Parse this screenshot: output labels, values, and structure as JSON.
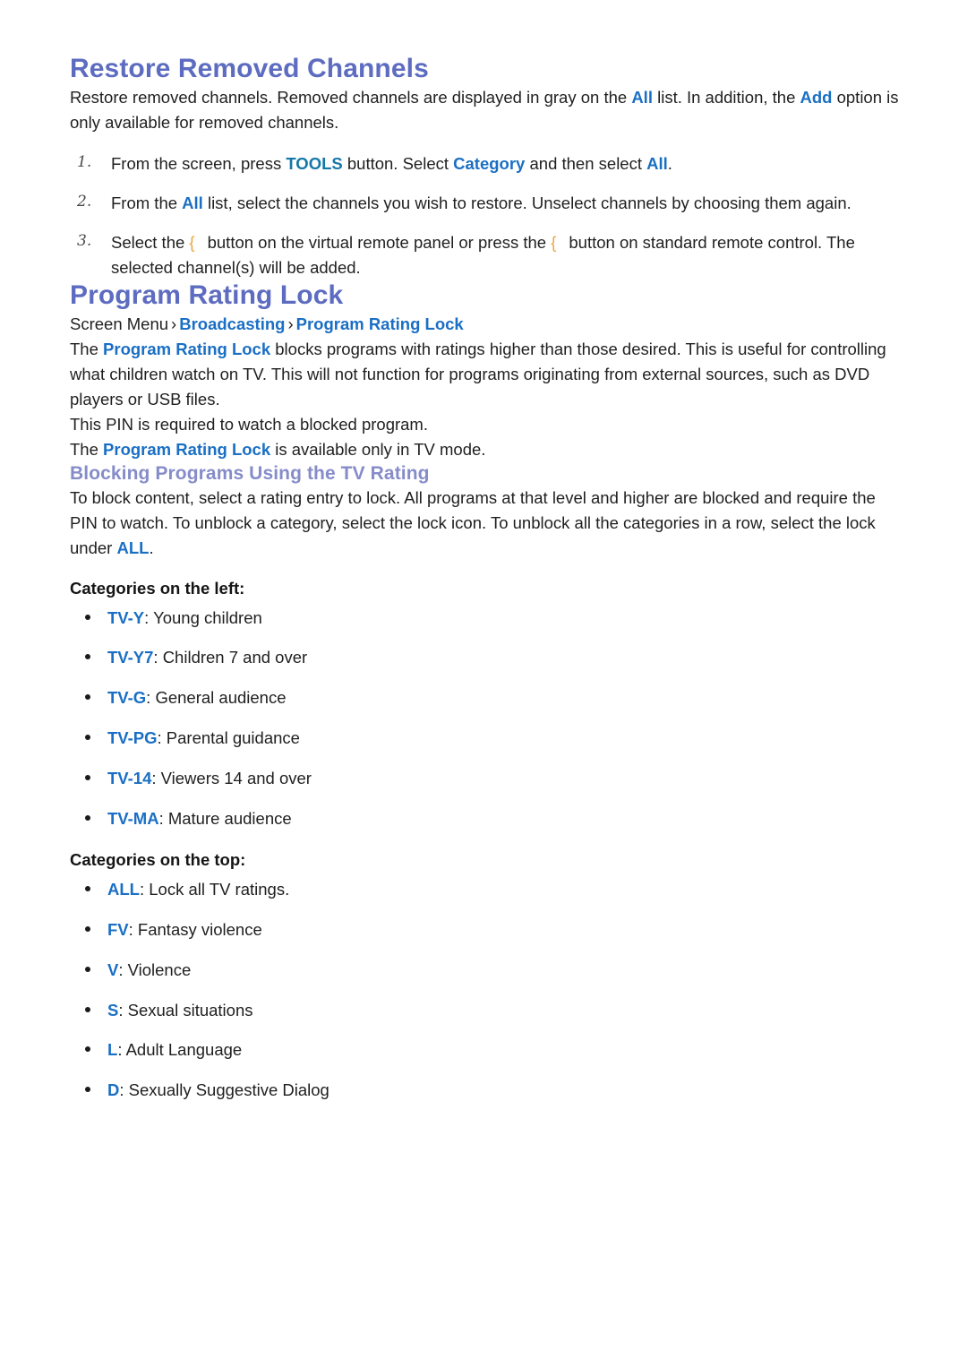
{
  "section_restore": {
    "heading": "Restore Removed Channels",
    "intro": {
      "part1": "Restore removed channels. Removed channels are displayed in gray on the ",
      "link1": "All",
      "part2": " list. In addition, the ",
      "link2": "Add",
      "part3": " option is only available for removed channels."
    },
    "steps": [
      {
        "num": "1.",
        "p1": "From the screen, press ",
        "l1": "TOOLS",
        "p2": " button. Select ",
        "l2": "Category",
        "p3": " and then select ",
        "l3": "All",
        "p4": "."
      },
      {
        "num": "2.",
        "p1": "From the ",
        "l1": "All",
        "p2": " list, select the channels you wish to restore. Unselect channels by choosing them again.",
        "l2": "",
        "p3": "",
        "l3": "",
        "p4": ""
      },
      {
        "num": "3.",
        "p1": "Select the ",
        "icon1": "{",
        "p2": "button on the virtual remote panel or press the ",
        "icon2": "{",
        "p3": "button on standard remote control. The selected channel(s) will be added."
      }
    ]
  },
  "section_rating_lock": {
    "heading": "Program Rating Lock",
    "breadcrumb": {
      "root": "Screen Menu",
      "sep": "›",
      "crumb1": "Broadcasting",
      "crumb2": "Program Rating Lock"
    },
    "description": {
      "p1": "The ",
      "l1": "Program Rating Lock",
      "p2": " blocks programs with ratings higher than those desired. This is useful for controlling what children watch on TV. This will not function for programs originating from external sources, such as DVD players or USB files."
    },
    "pin_note": "This PIN is required to watch a blocked program.",
    "tv_mode_note": {
      "p1": "The ",
      "l1": "Program Rating Lock",
      "p2": " is available only in TV mode."
    }
  },
  "section_blocking": {
    "heading": "Blocking Programs Using the TV Rating",
    "intro": {
      "p1": "To block content, select a rating entry to lock. All programs at that level and higher are blocked and require the PIN to watch. To unblock a category, select the lock icon. To unblock all the categories in a row, select the lock under ",
      "l1": "ALL",
      "p2": "."
    },
    "left_label": "Categories on the left:",
    "left_items": [
      {
        "term": "TV-Y",
        "desc": ": Young children"
      },
      {
        "term": "TV-Y7",
        "desc": ": Children 7 and over"
      },
      {
        "term": "TV-G",
        "desc": ": General audience"
      },
      {
        "term": "TV-PG",
        "desc": ": Parental guidance"
      },
      {
        "term": "TV-14",
        "desc": ": Viewers 14 and over"
      },
      {
        "term": "TV-MA",
        "desc": ": Mature audience"
      }
    ],
    "top_label": "Categories on the top:",
    "top_items": [
      {
        "term": "ALL",
        "desc": ": Lock all TV ratings."
      },
      {
        "term": "FV",
        "desc": ": Fantasy violence"
      },
      {
        "term": "V",
        "desc": ": Violence"
      },
      {
        "term": "S",
        "desc": ": Sexual situations"
      },
      {
        "term": "L",
        "desc": ": Adult Language"
      },
      {
        "term": "D",
        "desc": ": Sexually Suggestive Dialog"
      }
    ]
  },
  "colors": {
    "heading_primary": "#5d6cc0",
    "heading_secondary": "#868cc9",
    "link_blue": "#1a6fc4",
    "link_teal": "#1577a8",
    "remote_glyph": "#e8a33d",
    "body_text": "#1f1f1f"
  }
}
